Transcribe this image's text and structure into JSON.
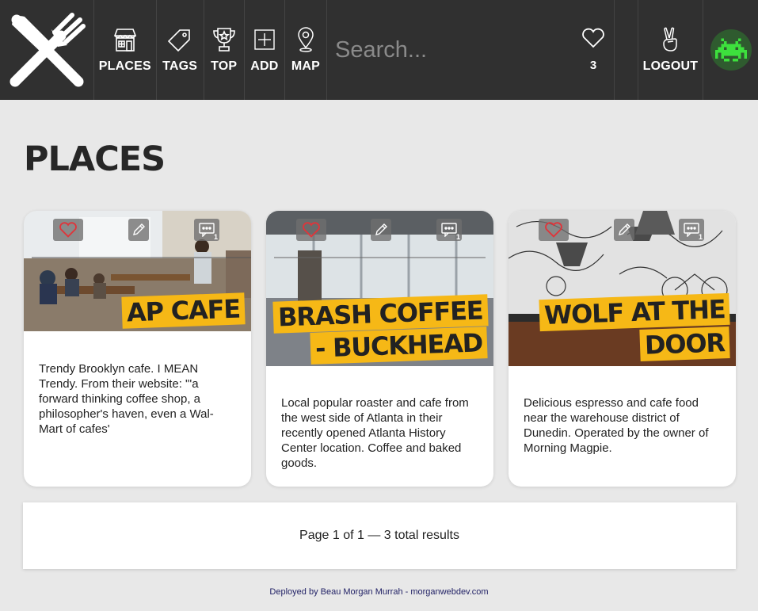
{
  "header": {
    "logo_icon": "fork-knife-icon",
    "nav": [
      {
        "label": "PLACES",
        "icon": "store-icon"
      },
      {
        "label": "TAGS",
        "icon": "tag-icon"
      },
      {
        "label": "TOP",
        "icon": "trophy-icon"
      },
      {
        "label": "ADD",
        "icon": "add-icon"
      },
      {
        "label": "MAP",
        "icon": "map-pin-icon"
      }
    ],
    "search": {
      "placeholder": "Search...",
      "value": ""
    },
    "hearts": {
      "count": "3",
      "icon": "heart-icon"
    },
    "logout": {
      "label": "LOGOUT",
      "icon": "peace-hand-icon"
    },
    "avatar_icon": "space-invader-avatar"
  },
  "page": {
    "title": "PLACES"
  },
  "cards": [
    {
      "title_lines": [
        "AP CAFE"
      ],
      "description": "Trendy Brooklyn cafe. I MEAN Trendy. From their website: \"'a forward thinking coffee shop, a philosopher's haven, even a Wal-Mart of cafes'",
      "comment_count": "1"
    },
    {
      "title_lines": [
        "BRASH COFFEE",
        "- BUCKHEAD"
      ],
      "description": "Local popular roaster and cafe from the west side of Atlanta in their recently opened Atlanta History Center location. Coffee and baked goods.",
      "comment_count": "1"
    },
    {
      "title_lines": [
        "WOLF AT THE",
        "DOOR"
      ],
      "description": "Delicious espresso and cafe food near the warehouse district of Dunedin. Operated by the owner of Morning Magpie.",
      "comment_count": "1"
    }
  ],
  "pagination": {
    "text": "Page 1 of 1 — 3 total results"
  },
  "footer": {
    "text": "Deployed by Beau Morgan Murrah - morganwebdev.com"
  },
  "colors": {
    "header_bg": "#303030",
    "accent_yellow": "#f6b816",
    "heart_red": "#e0343a",
    "page_bg": "#e8e8e8"
  }
}
